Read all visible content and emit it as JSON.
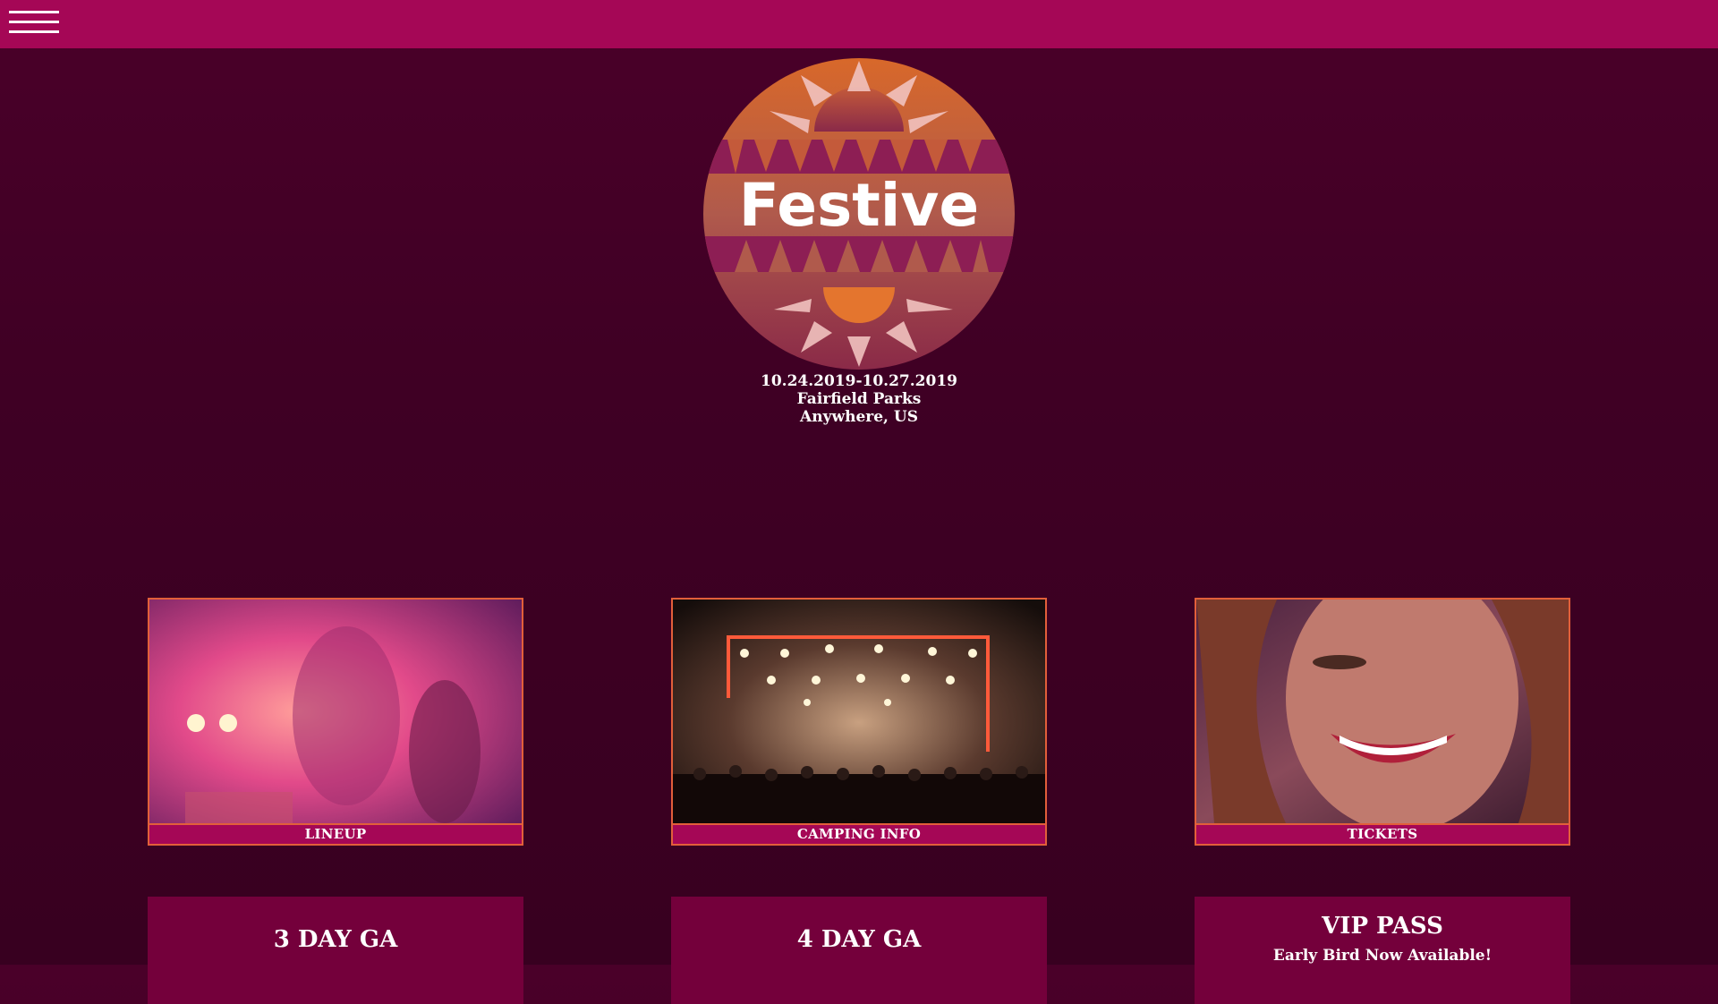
{
  "nav": {
    "menu_icon": "hamburger-menu-icon"
  },
  "logo": {
    "title": "Festive"
  },
  "event": {
    "dates": "10.24.2019-10.27.2019",
    "venue": "Fairfield Parks",
    "location": "Anywhere, US"
  },
  "cards": [
    {
      "label": "LINEUP"
    },
    {
      "label": "CAMPING INFO"
    },
    {
      "label": "TICKETS"
    }
  ],
  "tickets": [
    {
      "name": "3 DAY GA"
    },
    {
      "name": "4 DAY GA"
    },
    {
      "name": "VIP PASS",
      "subtitle": "Early Bird Now Available!"
    }
  ],
  "colors": {
    "topbar": "#a50756",
    "background": "#420026",
    "card_border": "#e25f3a",
    "ticket_bg": "#74003b"
  }
}
